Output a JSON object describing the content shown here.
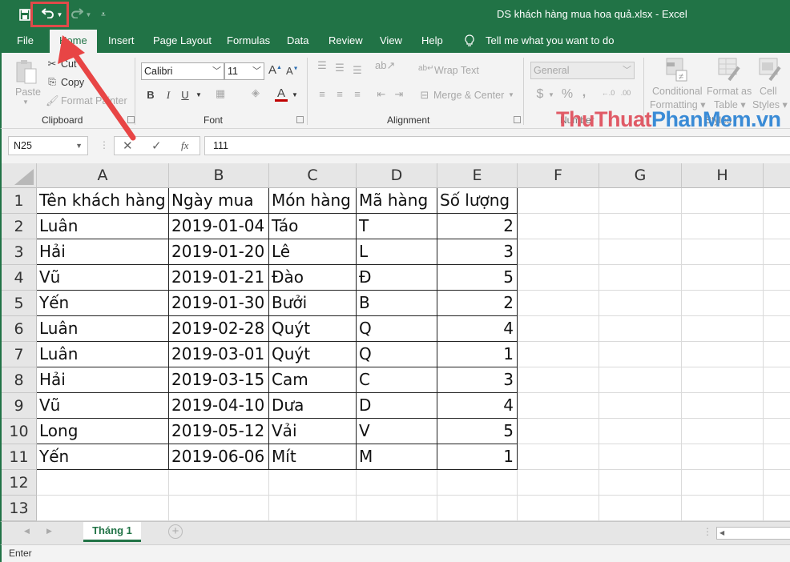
{
  "window": {
    "title": "DS khách hàng mua hoa quả.xlsx  -  Excel"
  },
  "quick_access": {
    "save_icon": "save-icon",
    "undo_icon": "undo-icon",
    "redo_icon": "redo-icon",
    "customize_icon": "customize-toolbar-icon"
  },
  "ribbon_tabs": [
    {
      "label": "File"
    },
    {
      "label": "Home",
      "active": true
    },
    {
      "label": "Insert"
    },
    {
      "label": "Page Layout"
    },
    {
      "label": "Formulas"
    },
    {
      "label": "Data"
    },
    {
      "label": "Review"
    },
    {
      "label": "View"
    },
    {
      "label": "Help"
    }
  ],
  "tell_me": "Tell me what you want to do",
  "ribbon": {
    "clipboard": {
      "label": "Clipboard",
      "paste": "Paste",
      "cut": "Cut",
      "copy": "Copy",
      "format_painter": "Format Painter"
    },
    "font": {
      "label": "Font",
      "font_name": "Calibri",
      "font_size": "11",
      "bold": "B",
      "italic": "I",
      "underline": "U"
    },
    "alignment": {
      "label": "Alignment",
      "wrap_text": "Wrap Text",
      "merge_center": "Merge & Center"
    },
    "number": {
      "label": "Number",
      "format": "General",
      "currency": "$",
      "percent": "%",
      "comma": ","
    },
    "styles": {
      "label": "Styles",
      "conditional_formatting": [
        "Conditional",
        "Formatting"
      ],
      "format_as_table": [
        "Format as",
        "Table"
      ],
      "cell_styles": [
        "Cell",
        "Styles"
      ]
    }
  },
  "formula_bar": {
    "name_box": "N25",
    "cancel_icon": "cancel-icon",
    "enter_icon": "enter-icon",
    "fx_label": "fx",
    "value": "111"
  },
  "grid": {
    "columns": [
      "A",
      "B",
      "C",
      "D",
      "E",
      "F",
      "G",
      "H"
    ],
    "row_numbers": [
      "1",
      "2",
      "3",
      "4",
      "5",
      "6",
      "7",
      "8",
      "9",
      "10",
      "11",
      "12",
      "13"
    ],
    "header": [
      "Tên khách hàng",
      "Ngày mua",
      "Món hàng",
      "Mã hàng",
      "Số lượng"
    ],
    "rows": [
      [
        "Luân",
        "2019-01-04",
        "Táo",
        "T",
        "2"
      ],
      [
        "Hải",
        "2019-01-20",
        "Lê",
        "L",
        "3"
      ],
      [
        "Vũ",
        "2019-01-21",
        "Đào",
        "Đ",
        "5"
      ],
      [
        "Yến",
        "2019-01-30",
        "Bưởi",
        "B",
        "2"
      ],
      [
        "Luân",
        "2019-02-28",
        "Quýt",
        "Q",
        "4"
      ],
      [
        "Luân",
        "2019-03-01",
        "Quýt",
        "Q",
        "1"
      ],
      [
        "Hải",
        "2019-03-15",
        "Cam",
        "C",
        "3"
      ],
      [
        "Vũ",
        "2019-04-10",
        "Dưa",
        "D",
        "4"
      ],
      [
        "Long",
        "2019-05-12",
        "Vải",
        "V",
        "5"
      ],
      [
        "Yến",
        "2019-06-06",
        "Mít",
        "M",
        "1"
      ]
    ]
  },
  "sheets": [
    {
      "label": "Tháng 1",
      "active": true
    }
  ],
  "status": "Enter",
  "watermark": {
    "part1": "ThuThuat",
    "part2": "PhanMem",
    "part3": ".vn"
  },
  "colors": {
    "excel_green": "#217346",
    "annotation_red": "#e04a4a"
  }
}
